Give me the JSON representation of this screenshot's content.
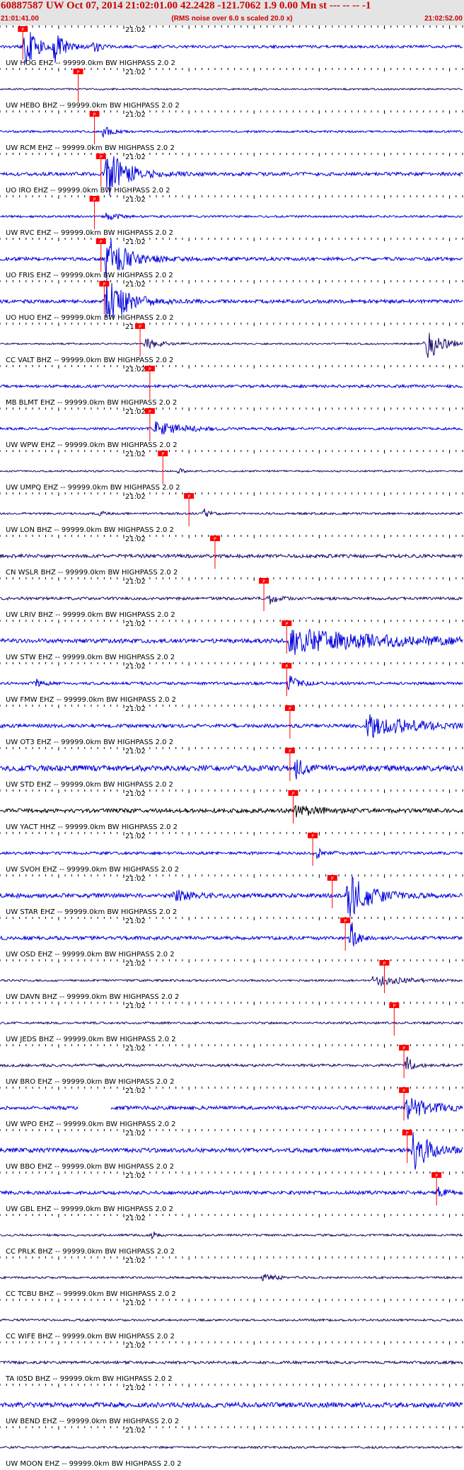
{
  "header": {
    "title": "60887587 UW Oct 07, 2014 21:02:01.00   42.2428 -121.7062  1.9 0.00 Mn st --- -- --  -1",
    "start_time": "21:01:41.00",
    "subtitle": "(RMS noise over 6.0 s scaled 20.0 x)",
    "end_time": "21:02:52.00"
  },
  "colors": {
    "header_bg": "#e4e4e4",
    "header_text": "#cc0000",
    "pick_marker": "#ff0000",
    "trace_blue": "#0000dd",
    "trace_navy": "#1a0a6e",
    "trace_black": "#000000",
    "tick_color": "#000000"
  },
  "chart_data": {
    "type": "seismogram",
    "x_start": "21:01:41.00",
    "x_end": "21:02:52.00",
    "minute_label": "21:02",
    "channel_suffix": "-- 99999.0km BW  HIGHPASS  2.0  2",
    "traces": [
      {
        "station": "UW.HOG.EHZ",
        "pick": "21:01:44.5",
        "color": "blue",
        "noise": 0.2,
        "bursts": [
          {
            "t": "21:01:44.5",
            "dur": 3.0,
            "amp": 3.5
          },
          {
            "t": "21:01:49.0",
            "dur": 3.0,
            "amp": 2.0
          },
          {
            "t": "21:01:55.0",
            "dur": 1.5,
            "amp": 1.2
          }
        ]
      },
      {
        "station": "UW.HEBO.BHZ",
        "pick": "21:01:53.0",
        "color": "navy",
        "noise": 0.12,
        "bursts": []
      },
      {
        "station": "UW.RCM.EHZ",
        "pick": "21:01:55.5",
        "color": "blue",
        "noise": 0.15,
        "bursts": [
          {
            "t": "21:01:56.5",
            "dur": 2.5,
            "amp": 0.7
          }
        ]
      },
      {
        "station": "UO.IRO.EHZ",
        "pick": "21:01:56.5",
        "color": "blue",
        "noise": 0.25,
        "bursts": [
          {
            "t": "21:01:57.0",
            "dur": 6.0,
            "amp": 3.5
          }
        ]
      },
      {
        "station": "UW.RVC.EHZ",
        "pick": "21:01:55.5",
        "color": "blue",
        "noise": 0.15,
        "bursts": [
          {
            "t": "21:01:57.0",
            "dur": 3.0,
            "amp": 0.6
          }
        ]
      },
      {
        "station": "UO.FRIS.EHZ",
        "pick": "21:01:56.5",
        "color": "blue",
        "noise": 0.25,
        "bursts": [
          {
            "t": "21:01:57.0",
            "dur": 6.0,
            "amp": 3.5
          }
        ]
      },
      {
        "station": "UO.HUO.EHZ",
        "pick": "21:01:57.0",
        "color": "blue",
        "noise": 0.25,
        "bursts": [
          {
            "t": "21:01:57.0",
            "dur": 6.0,
            "amp": 3.5
          }
        ]
      },
      {
        "station": "CC.VALT.BHZ",
        "pick": "21:02:02.5",
        "color": "navy",
        "noise": 0.12,
        "bursts": [
          {
            "t": "21:02:03.0",
            "dur": 4.0,
            "amp": 0.8
          },
          {
            "t": "21:02:46.0",
            "dur": 4.5,
            "amp": 2.5
          }
        ]
      },
      {
        "station": "MB.BLMT.EHZ",
        "pick": "21:02:04.0",
        "color": "blue",
        "noise": 0.2,
        "bursts": []
      },
      {
        "station": "UW.WPW.EHZ",
        "pick": "21:02:04.0",
        "color": "blue",
        "noise": 0.18,
        "bursts": [
          {
            "t": "21:02:04.5",
            "dur": 8.0,
            "amp": 0.9
          }
        ]
      },
      {
        "station": "UW.UMPQ.EHZ",
        "pick": "21:02:06.0",
        "color": "navy",
        "noise": 0.12,
        "bursts": [
          {
            "t": "21:02:08.0",
            "dur": 1.0,
            "amp": 0.5
          }
        ]
      },
      {
        "station": "UW.LON.BHZ",
        "pick": "21:02:10.0",
        "color": "navy",
        "noise": 0.15,
        "bursts": [
          {
            "t": "21:01:56.0",
            "dur": 1.0,
            "amp": 0.4
          },
          {
            "t": "21:02:12.0",
            "dur": 1.5,
            "amp": 0.6
          }
        ]
      },
      {
        "station": "CN.WSLR.BHZ",
        "pick": "21:02:14.0",
        "color": "navy",
        "noise": 0.25,
        "bursts": []
      },
      {
        "station": "UW.LRIV.BHZ",
        "pick": "21:02:21.5",
        "color": "navy",
        "noise": 0.2,
        "bursts": [
          {
            "t": "21:02:22.0",
            "dur": 2.0,
            "amp": 0.8
          }
        ]
      },
      {
        "station": "UW.STW.EHZ",
        "pick": "21:02:25.0",
        "color": "blue",
        "noise": 0.3,
        "bursts": [
          {
            "t": "21:02:25.0",
            "dur": 27.0,
            "amp": 1.8
          }
        ]
      },
      {
        "station": "UW.FMW.EHZ",
        "pick": "21:02:25.0",
        "color": "blue",
        "noise": 0.2,
        "bursts": [
          {
            "t": "21:01:46.0",
            "dur": 2.0,
            "amp": 0.6
          },
          {
            "t": "21:02:25.0",
            "dur": 3.0,
            "amp": 1.0
          }
        ]
      },
      {
        "station": "UW.OT3.EHZ",
        "pick": "21:02:25.5",
        "color": "blue",
        "noise": 0.25,
        "bursts": [
          {
            "t": "21:02:37.0",
            "dur": 12.0,
            "amp": 1.8
          }
        ]
      },
      {
        "station": "UW.STD.EHZ",
        "pick": "21:02:25.5",
        "color": "blue",
        "noise": 0.4,
        "bursts": [
          {
            "t": "21:02:26.0",
            "dur": 3.0,
            "amp": 1.3
          }
        ]
      },
      {
        "station": "UW.YACT.HHZ",
        "pick": "21:02:26.0",
        "color": "black",
        "noise": 0.3,
        "bursts": [
          {
            "t": "21:02:26.0",
            "dur": 6.0,
            "amp": 0.9
          }
        ]
      },
      {
        "station": "UW.SVOH.EHZ",
        "pick": "21:02:29.0",
        "color": "blue",
        "noise": 0.2,
        "bursts": [
          {
            "t": "21:02:29.0",
            "dur": 3.0,
            "amp": 0.7
          }
        ]
      },
      {
        "station": "UW.STAR.EHZ",
        "pick": "21:02:32.0",
        "color": "blue",
        "noise": 0.3,
        "bursts": [
          {
            "t": "21:02:07.5",
            "dur": 5.0,
            "amp": 0.8
          },
          {
            "t": "21:02:34.0",
            "dur": 6.0,
            "amp": 3.5
          }
        ]
      },
      {
        "station": "UW.OSD.EHZ",
        "pick": "21:02:34.0",
        "color": "blue",
        "noise": 0.25,
        "bursts": [
          {
            "t": "21:02:34.5",
            "dur": 1.5,
            "amp": 2.5
          }
        ]
      },
      {
        "station": "UW.DAVN.BHZ",
        "pick": "21:02:40.0",
        "color": "navy",
        "noise": 0.15,
        "bursts": [
          {
            "t": "21:02:38.0",
            "dur": 7.0,
            "amp": 1.0
          }
        ]
      },
      {
        "station": "UW.JEDS.BHZ",
        "pick": "21:02:41.5",
        "color": "navy",
        "noise": 0.15,
        "bursts": []
      },
      {
        "station": "UW.BRO.EHZ",
        "pick": "21:02:43.0",
        "color": "navy",
        "noise": 0.2,
        "bursts": [
          {
            "t": "21:02:43.0",
            "dur": 1.5,
            "amp": 1.5
          }
        ]
      },
      {
        "station": "UW.WPO.EHZ",
        "pick": "21:02:43.0",
        "color": "blue",
        "noise": 0.25,
        "bursts": [
          {
            "t": "21:02:43.0",
            "dur": 8.0,
            "amp": 1.5
          }
        ],
        "gap": [
          "21:01:53.0",
          "21:01:58.0"
        ]
      },
      {
        "station": "UW.BBO.EHZ",
        "pick": "21:02:43.5",
        "color": "blue",
        "noise": 0.3,
        "bursts": [
          {
            "t": "21:02:44.0",
            "dur": 5.0,
            "amp": 3.0
          }
        ]
      },
      {
        "station": "UW.GBL.EHZ",
        "pick": "21:02:48.0",
        "color": "blue",
        "noise": 0.25,
        "bursts": [
          {
            "t": "21:02:48.0",
            "dur": 2.5,
            "amp": 0.8
          }
        ]
      },
      {
        "station": "CC.PRLK.BHZ",
        "pick": "",
        "color": "navy",
        "noise": 0.15,
        "bursts": [
          {
            "t": "21:02:04.0",
            "dur": 1.0,
            "amp": 0.6
          }
        ]
      },
      {
        "station": "CC.TCBU.BHZ",
        "pick": "",
        "color": "navy",
        "noise": 0.15,
        "bursts": [
          {
            "t": "21:02:21.0",
            "dur": 4.0,
            "amp": 0.5
          }
        ]
      },
      {
        "station": "CC.WIFE.BHZ",
        "pick": "",
        "color": "navy",
        "noise": 0.15,
        "bursts": []
      },
      {
        "station": "TA.I05D.BHZ",
        "pick": "",
        "color": "navy",
        "noise": 0.2,
        "bursts": []
      },
      {
        "station": "UW.BEND.EHZ",
        "pick": "",
        "color": "blue",
        "noise": 0.35,
        "bursts": []
      },
      {
        "station": "UW.MOON.EHZ",
        "pick": "",
        "color": "navy",
        "noise": 0.15,
        "bursts": []
      }
    ]
  }
}
